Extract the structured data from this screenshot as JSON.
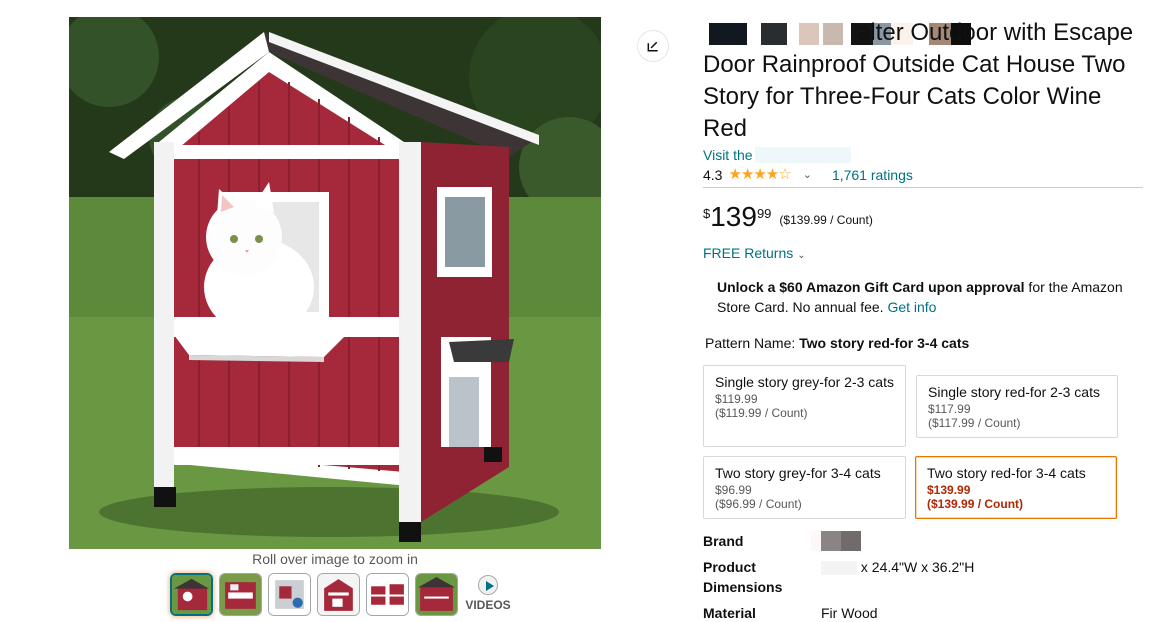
{
  "gallery": {
    "zoom_hint": "Roll over image to zoom in",
    "videos_label": "VIDEOS",
    "thumbnails": [
      "thumb-1",
      "thumb-2",
      "thumb-3",
      "thumb-4",
      "thumb-5",
      "thumb-6"
    ]
  },
  "product": {
    "title_partial_top": "alter Outdoor with Escape",
    "title": "Door Rainproof Outside Cat House Two Story for Three-Four Cats Color Wine Red",
    "byline": "Visit the Store",
    "rating": "4.3",
    "ratings_count": "1,761 ratings"
  },
  "price": {
    "symbol": "$",
    "whole": "139",
    "fraction": "99",
    "per_unit": "($139.99 / Count)"
  },
  "returns": {
    "label": "FREE Returns"
  },
  "gift_card": {
    "bold": "Unlock a $60 Amazon Gift Card upon approval",
    "text": " for the Amazon Store Card. No annual fee. ",
    "link": "Get info"
  },
  "pattern": {
    "label": "Pattern Name:",
    "selected": "Two story red-for 3-4 cats",
    "options": [
      {
        "name": "Single story grey-for 2-3 cats",
        "price": "$119.99",
        "unit": "($119.99 / Count)"
      },
      {
        "name": "Single story red-for 2-3 cats",
        "price": "$117.99",
        "unit": "($117.99 / Count)"
      },
      {
        "name": "Two story grey-for 3-4 cats",
        "price": "$96.99",
        "unit": "($96.99 / Count)"
      },
      {
        "name": "Two story red-for 3-4 cats",
        "price": "$139.99",
        "unit": "($139.99 / Count)"
      }
    ]
  },
  "specs": [
    {
      "key": "Brand",
      "value": ""
    },
    {
      "key": "Product Dimensions",
      "value": "x 24.4\"W x 36.2\"H"
    },
    {
      "key": "Material",
      "value": "Fir Wood"
    }
  ],
  "colors": {
    "link": "#007185",
    "star": "#ffa41c",
    "price_red": "#b12704",
    "selected_border": "#e77600",
    "house_red": "#a52a3a"
  }
}
